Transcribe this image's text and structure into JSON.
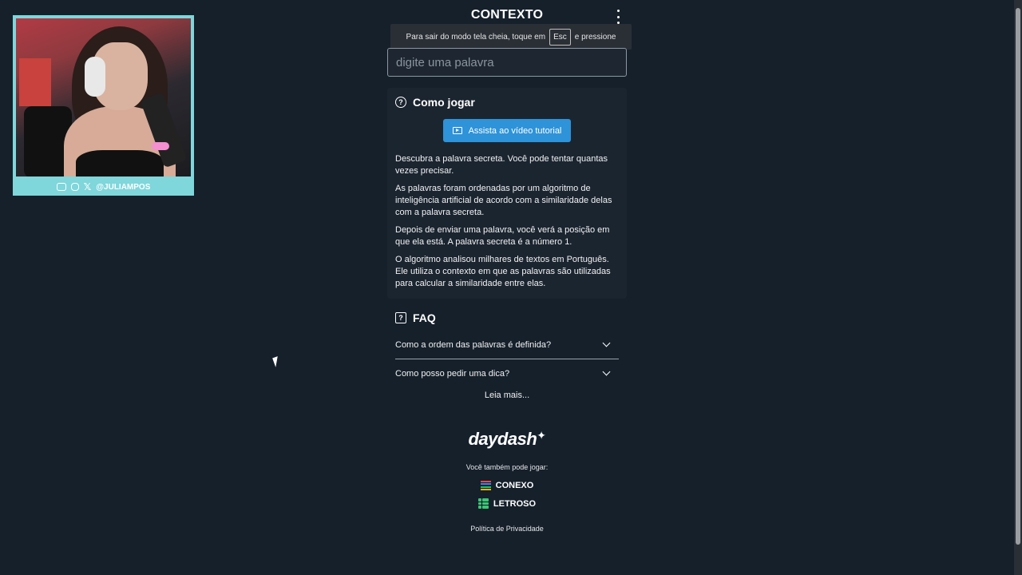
{
  "webcam": {
    "handle": "@JULIAMPOS"
  },
  "header": {
    "title": "CONTEXTO"
  },
  "fullscreen_toast": {
    "text_before": "Para sair do modo tela cheia, toque em",
    "key": "Esc",
    "text_after": "e pressione"
  },
  "search": {
    "placeholder": "digite uma palavra",
    "value": ""
  },
  "how_to_play": {
    "title": "Como jogar",
    "video_button": "Assista ao vídeo tutorial",
    "paragraphs": [
      "Descubra a palavra secreta. Você pode tentar quantas vezes precisar.",
      "As palavras foram ordenadas por um algoritmo de inteligência artificial de acordo com a similaridade delas com a palavra secreta.",
      "Depois de enviar uma palavra, você verá a posição em que ela está. A palavra secreta é a número 1.",
      "O algoritmo analisou milhares de textos em Português. Ele utiliza o contexto em que as palavras são utilizadas para calcular a similaridade entre elas."
    ]
  },
  "faq": {
    "title": "FAQ",
    "items": [
      {
        "question": "Como a ordem das palavras é definida?"
      },
      {
        "question": "Como posso pedir uma dica?"
      }
    ],
    "read_more": "Leia mais..."
  },
  "footer": {
    "logo_text": "daydash",
    "also_play": "Você também pode jogar:",
    "games": [
      {
        "name": "CONEXO",
        "colors": [
          "#e84a4a",
          "#3b82f6",
          "#22c55e",
          "#eab308"
        ]
      },
      {
        "name": "LETROSO",
        "color": "#3cc774"
      }
    ],
    "privacy": "Política de Privacidade"
  },
  "colors": {
    "background": "#15202b",
    "card": "#1b2530",
    "button": "#2e93d9",
    "webcam_frame": "#7fd6db"
  }
}
